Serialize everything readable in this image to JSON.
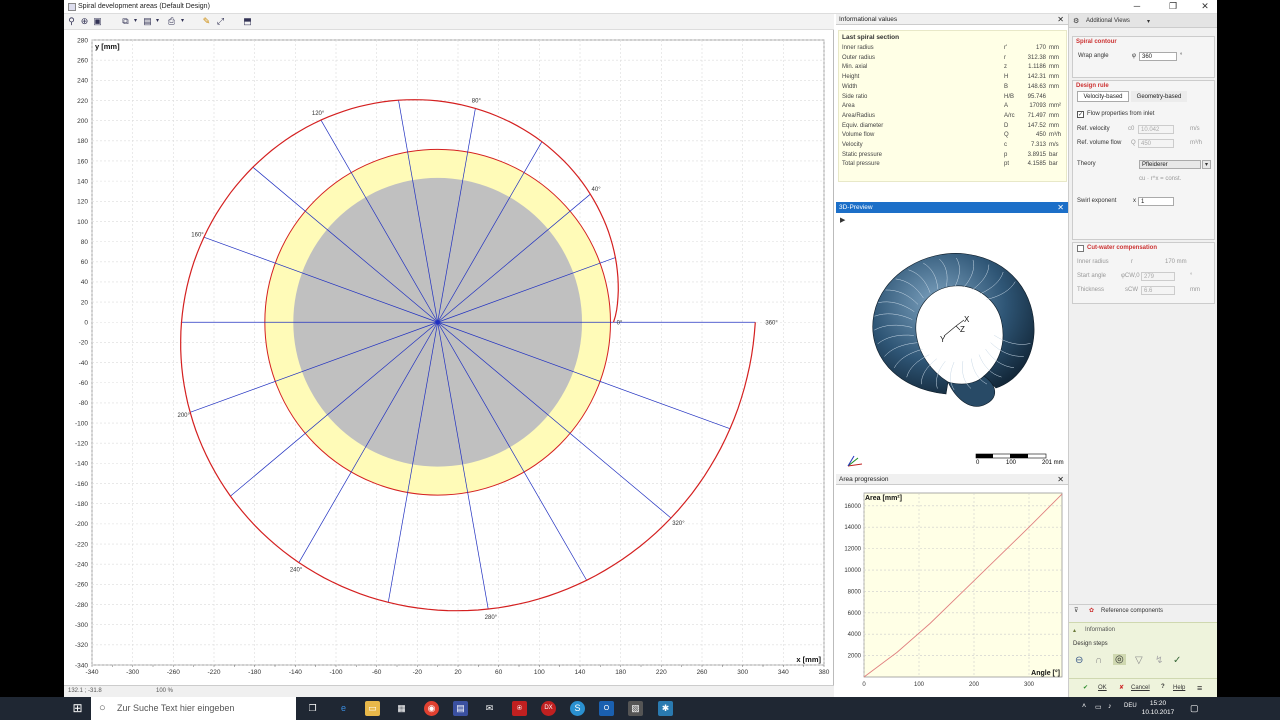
{
  "window": {
    "title": "Spiral development areas (Default Design)"
  },
  "chart_main": {
    "type": "line",
    "ylabel": "y [mm]",
    "xlabel": "x [mm]",
    "xlim": [
      -340,
      380
    ],
    "ylim": [
      -340,
      280
    ],
    "x_ticks": [
      -340,
      -300,
      -260,
      -220,
      -180,
      -140,
      -100,
      -60,
      -20,
      20,
      60,
      100,
      140,
      180,
      220,
      260,
      300,
      340,
      380
    ],
    "y_ticks": [
      280,
      260,
      240,
      220,
      200,
      180,
      160,
      140,
      120,
      100,
      80,
      60,
      40,
      20,
      0,
      -20,
      -40,
      -60,
      -80,
      -100,
      -120,
      -140,
      -160,
      -180,
      -200,
      -220,
      -240,
      -260,
      -280,
      -300,
      -320,
      -340
    ],
    "angle_labels": [
      {
        "text": "0°",
        "deg": 0
      },
      {
        "text": "40°",
        "deg": 40
      },
      {
        "text": "80°",
        "deg": 80
      },
      {
        "text": "120°",
        "deg": 120
      },
      {
        "text": "160°",
        "deg": 160
      },
      {
        "text": "200°",
        "deg": 200
      },
      {
        "text": "240°",
        "deg": 240
      },
      {
        "text": "280°",
        "deg": 280
      },
      {
        "text": "320°",
        "deg": 320
      },
      {
        "text": "360°",
        "deg": 360
      }
    ],
    "center": {
      "x": 0,
      "y": 0
    },
    "inner_radius": 170,
    "outer_radius_end": 312.38,
    "inlet_radius": 142,
    "cutwater_radius": 170,
    "spiral_color": "#d42020",
    "ray_color": "#2030c0",
    "fill_inner": "#c0c0c0",
    "fill_ring": "#fffbb8"
  },
  "status": {
    "coords": "132.1 ; -31.8",
    "zoom": "100 %"
  },
  "info_panel": {
    "title": "Informational values",
    "section": "Last spiral section",
    "rows": [
      {
        "name": "Inner radius",
        "sym": "r'",
        "val": "170",
        "unit": "mm"
      },
      {
        "name": "Outer radius",
        "sym": "r",
        "val": "312.38",
        "unit": "mm"
      },
      {
        "name": "Min. axial",
        "sym": "z",
        "val": "1.1186",
        "unit": "mm"
      },
      {
        "name": "Height",
        "sym": "H",
        "val": "142.31",
        "unit": "mm"
      },
      {
        "name": "Width",
        "sym": "B",
        "val": "148.63",
        "unit": "mm"
      },
      {
        "name": "Side ratio",
        "sym": "H/B",
        "val": "95.746",
        "unit": ""
      },
      {
        "name": "Area",
        "sym": "A",
        "val": "17093",
        "unit": "mm²"
      },
      {
        "name": "Area/Radius",
        "sym": "A/rc",
        "val": "71.497",
        "unit": "mm"
      },
      {
        "name": "Equiv. diameter",
        "sym": "D",
        "val": "147.52",
        "unit": "mm"
      },
      {
        "name": "Volume flow",
        "sym": "Q",
        "val": "450",
        "unit": "m³/h"
      },
      {
        "name": "Velocity",
        "sym": "c",
        "val": "7.313",
        "unit": "m/s"
      },
      {
        "name": "Static pressure",
        "sym": "p",
        "val": "3.8915",
        "unit": "bar"
      },
      {
        "name": "Total pressure",
        "sym": "pt",
        "val": "4.1585",
        "unit": "bar"
      }
    ]
  },
  "preview_panel": {
    "title": "3D-Preview",
    "scale": [
      "0",
      "100",
      "201 mm"
    ],
    "axes": [
      "X",
      "Y",
      "Z"
    ]
  },
  "area_panel": {
    "title": "Area progression",
    "chart_data": {
      "type": "line",
      "ylabel": "Area [mm²]",
      "xlabel": "Angle [°]",
      "x": [
        0,
        60,
        120,
        180,
        240,
        300,
        360
      ],
      "y": [
        0,
        2300,
        5000,
        8000,
        11000,
        14000,
        17093
      ],
      "xlim": [
        0,
        360
      ],
      "ylim": [
        0,
        17200
      ],
      "x_ticks": [
        0,
        100,
        200,
        300
      ],
      "y_ticks": [
        2000,
        4000,
        6000,
        8000,
        10000,
        12000,
        14000,
        16000
      ],
      "line_color": "#e08080",
      "bg": "#ffffe6"
    }
  },
  "props": {
    "header": "Additional Views",
    "spiral_contour": "Spiral contour",
    "wrap_angle_label": "Wrap angle",
    "wrap_angle_sym": "φ",
    "wrap_angle_val": "360",
    "wrap_angle_unit": "°",
    "design_rule": "Design rule",
    "tab_velocity": "Velocity-based",
    "tab_geometry": "Geometry-based",
    "flow_from_inlet": "Flow properties from inlet",
    "ref_velocity_label": "Ref. velocity",
    "ref_velocity_sym": "c0",
    "ref_velocity_val": "10.042",
    "ref_velocity_unit": "m/s",
    "ref_volume_label": "Ref. volume flow",
    "ref_volume_sym": "Q",
    "ref_volume_val": "450",
    "ref_volume_unit": "m³/h",
    "theory_label": "Theory",
    "theory_val": "Pfleiderer",
    "theory_formula": "cu · r^x = const.",
    "swirl_label": "Swirl exponent",
    "swirl_sym": "x",
    "swirl_val": "1",
    "cutwater": "Cut-water compensation",
    "cw_inner_label": "Inner radius",
    "cw_inner_sym": "r",
    "cw_inner_val": "170 mm",
    "cw_start_label": "Start angle",
    "cw_start_sym": "φCW,0",
    "cw_start_val": "279",
    "cw_start_unit": "°",
    "cw_thick_label": "Thickness",
    "cw_thick_sym": "sCW",
    "cw_thick_val": "6.6",
    "cw_thick_unit": "mm",
    "reference_components": "Reference components",
    "information": "Information",
    "design_steps": "Design steps",
    "ok": "OK",
    "cancel": "Cancel",
    "help": "Help"
  },
  "taskbar": {
    "search_placeholder": "Zur Suche Text hier eingeben",
    "lang": "DEU",
    "time": "15:20",
    "date": "10.10.2017"
  }
}
